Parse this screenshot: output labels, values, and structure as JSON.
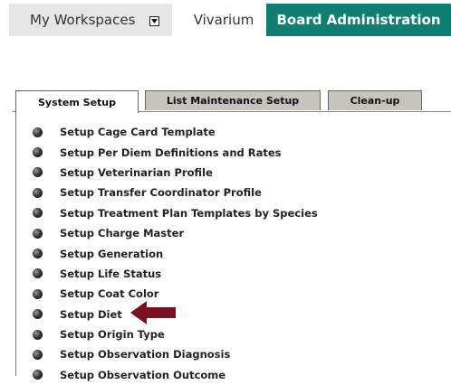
{
  "topnav": {
    "my_workspaces": "My Workspaces",
    "vivarium": "Vivarium",
    "board_admin": "Board Administration"
  },
  "tabs": [
    {
      "label": "System Setup",
      "active": true
    },
    {
      "label": "List Maintenance Setup",
      "active": false
    },
    {
      "label": "Clean-up",
      "active": false
    }
  ],
  "menu": [
    "Setup Cage Card Template",
    "Setup Per Diem Definitions and Rates",
    "Setup Veterinarian Profile",
    "Setup Transfer Coordinator Profile",
    "Setup Treatment Plan Templates by Species",
    "Setup Charge Master",
    "Setup Generation",
    "Setup Life Status",
    "Setup Coat Color",
    "Setup Diet",
    "Setup Origin Type",
    "Setup Observation Diagnosis",
    "Setup Observation Outcome"
  ],
  "colors": {
    "board_bg": "#0f7f74",
    "tab_inactive": "#c9c3be",
    "arrow": "#7a1020"
  },
  "icons": {
    "dropdown": "dropdown-icon",
    "bullet": "bullet-icon",
    "pointer": "arrow-left-icon"
  }
}
